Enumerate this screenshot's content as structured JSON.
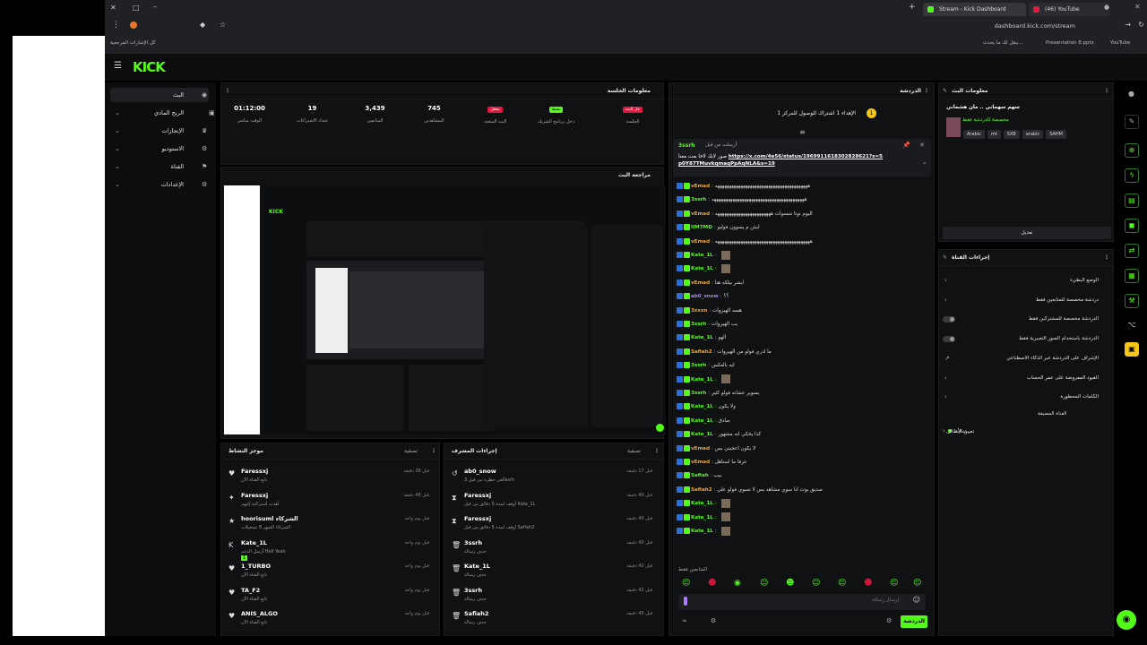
{
  "browser": {
    "tabs": [
      {
        "label": "Stream - Kick Dashboard",
        "active": true
      },
      {
        "label": "(46) YouTube",
        "active": false
      }
    ],
    "url": "dashboard.kick.com/stream",
    "bookmarks_label": "كل الإشارات المرجعية",
    "bookmarks": [
      "ينقل لك ما يحدث...",
      "Presentation 8.pptx",
      "YouTube"
    ]
  },
  "brand": {
    "logo": "KICK",
    "accent": "#53fc18"
  },
  "nav": {
    "items": [
      {
        "label": "البث",
        "icon": "broadcast-icon",
        "selected": true
      },
      {
        "label": "الربح المادي",
        "icon": "money-icon"
      },
      {
        "label": "الإنجازات",
        "icon": "trophy-icon"
      },
      {
        "label": "الاستوديو",
        "icon": "studio-icon"
      },
      {
        "label": "القناة",
        "icon": "channel-icon"
      },
      {
        "label": "الإعدادات",
        "icon": "gear-icon"
      }
    ]
  },
  "session": {
    "title": "معلومات الجلسة",
    "stats": [
      {
        "value": "01:12:00",
        "label": "الوقت مباشر"
      },
      {
        "value": "19",
        "label": "تحداد الاشتراكات"
      },
      {
        "value": "3,439",
        "label": "المتابعين"
      },
      {
        "value": "745",
        "label": "المشاهدين"
      },
      {
        "badge": "مفعل",
        "label": "البث المتعدد",
        "badge_color": "#e5173f"
      },
      {
        "badge": "نشط",
        "label": "دخل برنامج الشريك",
        "badge_color": "#53fc18"
      },
      {
        "badge": "جار البث",
        "label": "الجلسة",
        "badge_color": "#e5173f"
      }
    ]
  },
  "preview": {
    "title": "مراجعة البث"
  },
  "activity": {
    "title": "موجز النشاط",
    "filter": "تصفية",
    "items": [
      {
        "name": "Faressxj",
        "sub": "تابع القناة الآن",
        "time": "قبل 38 دقيقة",
        "icon": "heart-icon"
      },
      {
        "name": "Faressxj",
        "sub": "أهدت أشتراكية إليهم",
        "time": "قبل 48 دقيقة",
        "icon": "gift-icon"
      },
      {
        "name": "hoorisuml الشركاء",
        "sub": "الشركاء الشهر 8 تسجيلات",
        "time": "قبل يوم واحد",
        "icon": "star-icon"
      },
      {
        "name": "Kate_1L",
        "sub": "أرسل الدعم Hell Yeah",
        "time": "قبل يوم واحد",
        "icon": "kick-icon",
        "extra": "1"
      },
      {
        "name": "1_TURBO",
        "sub": "تابع القناة الآن",
        "time": "قبل يوم واحد",
        "icon": "heart-icon"
      },
      {
        "name": "TA_F2",
        "sub": "تابع القناة الآن",
        "time": "قبل يوم واحد",
        "icon": "heart-icon"
      },
      {
        "name": "ANIS_ALGO",
        "sub": "تابع القناة الآن",
        "time": "قبل يوم واحد",
        "icon": "heart-icon"
      }
    ]
  },
  "modactions": {
    "title": "إجراءات المشرف",
    "filter": "تصفية",
    "items": [
      {
        "name": "ab0_snow",
        "sub": "ألغي حظره من قبل 3ssrh",
        "time": "قبل 17 دقيقة",
        "icon": "undo-icon"
      },
      {
        "name": "Faressxj",
        "sub": "أوقف لمدة 5 دقائق من قبل Kate_1L",
        "time": "قبل 40 دقيقة",
        "icon": "hourglass-icon"
      },
      {
        "name": "Faressxj",
        "sub": "أوقف لمدة 5 دقائق من قبل Safiah2",
        "time": "قبل 40 دقيقة",
        "icon": "hourglass-icon"
      },
      {
        "name": "3ssrh",
        "sub": "حذف رسالة",
        "time": "قبل 40 دقيقة",
        "icon": "trash-icon"
      },
      {
        "name": "Kate_1L",
        "sub": "حذف رسالة",
        "time": "قبل 42 دقيقة",
        "icon": "trash-icon"
      },
      {
        "name": "3ssrh",
        "sub": "حذف رسالة",
        "time": "قبل 42 دقيقة",
        "icon": "trash-icon"
      },
      {
        "name": "Safiah2",
        "sub": "حذف رسالة",
        "time": "قبل 45 دقيقة",
        "icon": "trash-icon"
      }
    ]
  },
  "chat": {
    "title": "الدردشة",
    "goal": "الإهداء 1 اشتراك للوصول للمركز 1",
    "pinned_by": "3ssrh",
    "pinned_label": "أرسلت من قبل",
    "pinned_link": "https://x.com/4e56/status/1969911618302828621?s=5p0Y87TMuvkqmaqPpAqNLA&s=19",
    "pinned_text": "صور لابك لاخا بعث معنا",
    "input_placeholder": "إرسال رسالة",
    "send_label": "الدردشة",
    "followers_only": "المتابعين فقط",
    "messages": [
      {
        "user": "vEmad",
        "color": "#f5a623",
        "msg": "ههههههههههههههههههههههههههههههههههههههههه"
      },
      {
        "user": "3ssrh",
        "color": "#53fc18",
        "msg": "ههههههههههههههههههههههههههههههههههههههههه"
      },
      {
        "user": "vEmad",
        "color": "#f5a623",
        "msg": "اليوم نوتا شسوات ههههههههههههههههههههههههه"
      },
      {
        "user": "IIM7MD",
        "color": "#53fc18",
        "msg": "ايش م يسوون فوليو"
      },
      {
        "user": "vEmad",
        "color": "#f5a623",
        "msg": "هههههههههههههههههههههههههههههههههههههههههه"
      },
      {
        "user": "Kate_1L",
        "color": "#53fc18",
        "msg": ""
      },
      {
        "user": "Kate_1L",
        "color": "#53fc18",
        "msg": ""
      },
      {
        "user": "vEmad",
        "color": "#f5a623",
        "msg": "ابشر بيلكه هنا"
      },
      {
        "user": "ab0_snow",
        "color": "#b07cff",
        "msg": "؟؟"
      },
      {
        "user": "3zxxn",
        "color": "#f5a623",
        "msg": "هسه الهيروات"
      },
      {
        "user": "3ssrh",
        "color": "#53fc18",
        "msg": "يب الهيروات"
      },
      {
        "user": "Kate_1L",
        "color": "#53fc18",
        "msg": "الهو"
      },
      {
        "user": "Safiah2",
        "color": "#f5a623",
        "msg": "ما ادري فولو من الهيروات"
      },
      {
        "user": "3ssrh",
        "color": "#53fc18",
        "msg": "ايه بالعكس"
      },
      {
        "user": "Kate_1L",
        "color": "#53fc18",
        "msg": ""
      },
      {
        "user": "3ssrh",
        "color": "#53fc18",
        "msg": "يسوير عشانه فولو كثير"
      },
      {
        "user": "Kate_1L",
        "color": "#53fc18",
        "msg": "ولا يكون"
      },
      {
        "user": "Kate_1L",
        "color": "#53fc18",
        "msg": "صادق"
      },
      {
        "user": "Kate_1L",
        "color": "#53fc18",
        "msg": "كذا يحكي انه مشهور"
      },
      {
        "user": "vEmad",
        "color": "#f5a623",
        "msg": "لا يكون اعجبني بس"
      },
      {
        "user": "vEmad",
        "color": "#f5a623",
        "msg": "عرفا ما استاهل"
      },
      {
        "user": "Safiah",
        "color": "#53fc18",
        "msg": "بيب"
      },
      {
        "user": "Safiah2",
        "color": "#f5a623",
        "msg": "صديق بوت انا سوي مشاهد بس لا تسوي فولو علي"
      },
      {
        "user": "Kate_1L",
        "color": "#53fc18",
        "msg": ""
      },
      {
        "user": "Kate_1L",
        "color": "#53fc18",
        "msg": ""
      },
      {
        "user": "Kate_1L",
        "color": "#53fc18",
        "msg": ""
      }
    ]
  },
  "streaminfo": {
    "title": "معلومات البث",
    "stream_title": "سهم سهماني .. مان هشماني",
    "category": "مخصصة الدردشة فقط",
    "tags": [
      "Arabic",
      "mt",
      "SXB",
      "arabic",
      "SAHM"
    ],
    "edit_label": "تعديل"
  },
  "channelactions": {
    "title": "إجراءات القناة",
    "items": [
      {
        "label": "الوضع البطيء",
        "control": "chevron"
      },
      {
        "label": "دردشة مخصصة للمتابعين فقط",
        "control": "chevron"
      },
      {
        "label": "الدردشة مخصصة للمشتركين فقط",
        "control": "toggle"
      },
      {
        "label": "الدردشة باستخدام الصور التعبيرية فقط",
        "control": "toggle"
      },
      {
        "label": "الإشراف على الدردشة عبر الذكاء الاصطناعي",
        "control": "external"
      },
      {
        "label": "القيود المفروضة على عمر الحساب",
        "control": "chevron"
      },
      {
        "label": "الكلمات المحظورة",
        "control": "chevron"
      }
    ],
    "section_label": "القناة المضيفة",
    "goal_label": "تعيين الأهداف",
    "goal_status": "فعال 1"
  }
}
